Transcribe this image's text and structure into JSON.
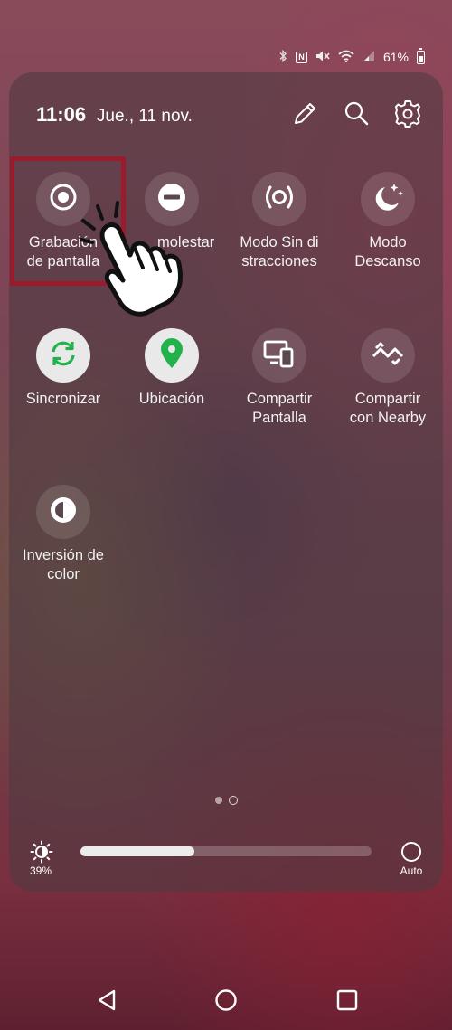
{
  "status_bar": {
    "icons": [
      "bluetooth-icon",
      "nfc-icon",
      "mute-icon",
      "wifi-icon",
      "signal-icon"
    ],
    "battery_percent": "61%"
  },
  "header": {
    "time": "11:06",
    "date": "Jue., 11 nov.",
    "actions": [
      "edit-icon",
      "search-icon",
      "settings-icon"
    ]
  },
  "tiles": [
    {
      "label": "Grabación de pantalla",
      "icon": "screen-record-icon",
      "active": false
    },
    {
      "label": "No molestar",
      "icon": "do-not-disturb-icon",
      "active": false
    },
    {
      "label": "Modo Sin di stracciones",
      "icon": "focus-mode-icon",
      "active": false
    },
    {
      "label": "Modo Descanso",
      "icon": "bedtime-icon",
      "active": false
    },
    {
      "label": "Sincronizar",
      "icon": "sync-icon",
      "active": true
    },
    {
      "label": "Ubicación",
      "icon": "location-icon",
      "active": true
    },
    {
      "label": "Compartir Pantalla",
      "icon": "screen-share-icon",
      "active": false
    },
    {
      "label": "Compartir con Nearby",
      "icon": "nearby-share-icon",
      "active": false
    },
    {
      "label": "Inversión de color",
      "icon": "color-inversion-icon",
      "active": false
    }
  ],
  "tile_labels_visible": {
    "t0": "Grabación\nde pantalla",
    "t1": "molestar",
    "t2": "Modo Sin di\nstracciones",
    "t3": "Modo\nDescanso",
    "t4": "Sincronizar",
    "t5": "Ubicación",
    "t6": "Compartir\nPantalla",
    "t7": "Compartir\ncon Nearby",
    "t8": "Inversión de\ncolor"
  },
  "pager": {
    "current_page": 1,
    "total_pages": 2
  },
  "brightness": {
    "percent_label": "39%",
    "level": 0.39,
    "auto_label": "Auto"
  },
  "colors": {
    "accent_green": "#22b24c",
    "highlight_red": "#9b1a2c"
  },
  "nav": [
    "back-icon",
    "home-icon",
    "recents-icon"
  ]
}
